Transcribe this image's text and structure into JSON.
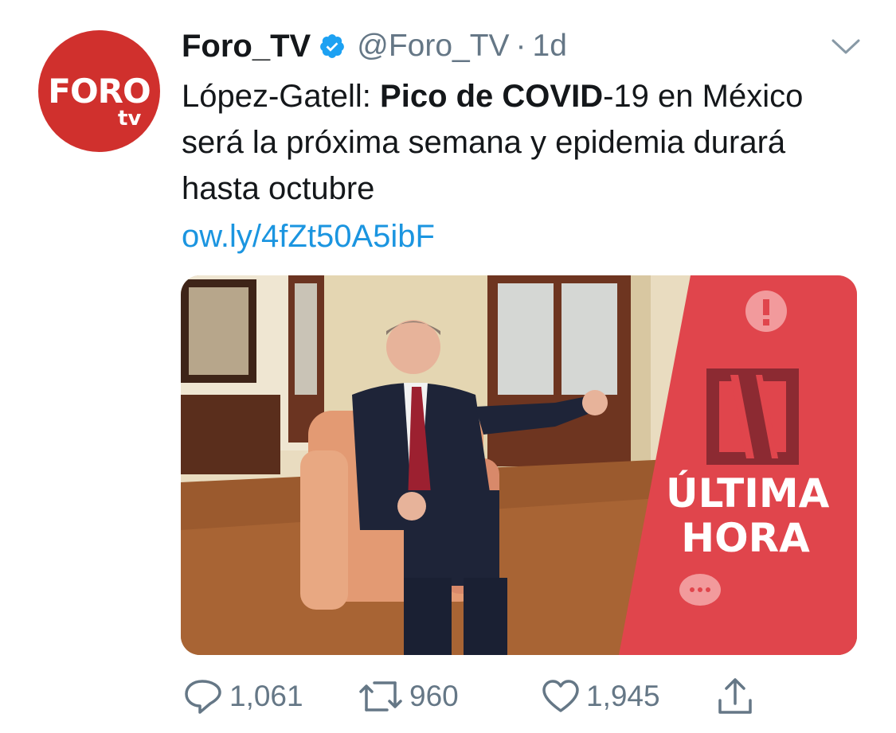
{
  "author": {
    "display_name": "Foro_TV",
    "handle": "@Foro_TV",
    "separator": "·",
    "time": "1d",
    "avatar": {
      "main_text": "FORO",
      "sub_text": "tv",
      "color": "#d0302d"
    },
    "verified": true
  },
  "tweet": {
    "text_parts": [
      {
        "text": "López-Gatell: ",
        "bold": false
      },
      {
        "text": "Pico de COVID",
        "bold": true
      },
      {
        "text": "-19 en México será la próxima semana y epidemia durará hasta octubre",
        "bold": false
      }
    ],
    "link": "ow.ly/4fZt50A5ibF"
  },
  "media": {
    "banner_text_line1": "ÚLTIMA",
    "banner_text_line2": "HORA",
    "banner_color": "#e0454c"
  },
  "actions": {
    "reply_count": "1,061",
    "retweet_count": "960",
    "like_count": "1,945"
  },
  "colors": {
    "text": "#14171a",
    "secondary": "#657786",
    "link": "#1b95e0",
    "verified": "#1da1f2"
  }
}
